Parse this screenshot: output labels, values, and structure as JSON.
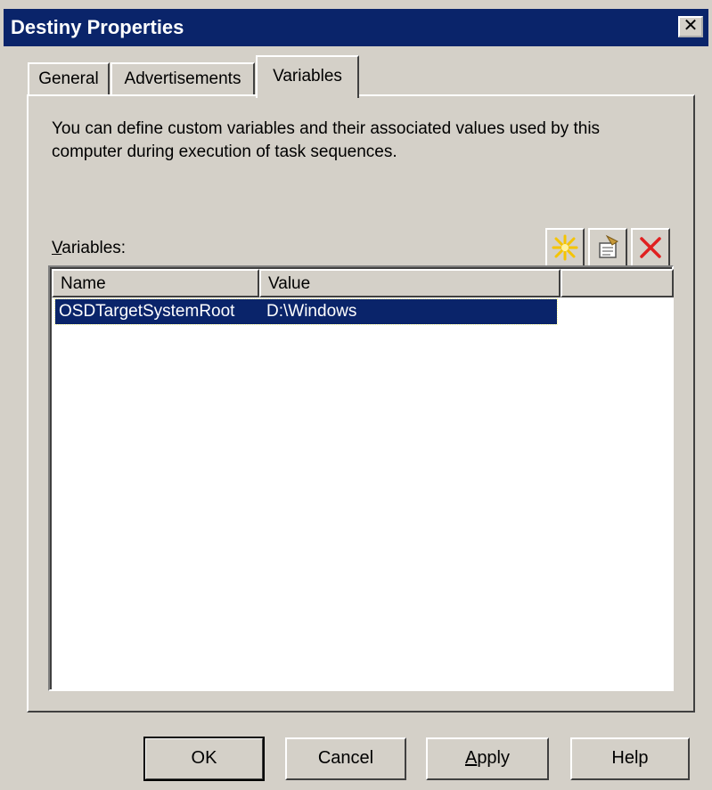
{
  "window": {
    "title": "Destiny Properties",
    "close_glyph": "✕"
  },
  "tabs": [
    {
      "label": "General",
      "selected": false
    },
    {
      "label": "Advertisements",
      "selected": false
    },
    {
      "label": "Variables",
      "selected": true
    }
  ],
  "variables_tab": {
    "description": "You can define custom variables and their associated values used by this computer during execution of task sequences.",
    "label_prefix": "V",
    "label_rest": "ariables:",
    "toolbar": {
      "new_icon": "new-star-icon",
      "properties_icon": "properties-icon",
      "delete_icon": "delete-x-icon"
    },
    "table": {
      "columns": [
        "Name",
        "Value"
      ],
      "rows": [
        {
          "name": "OSDTargetSystemRoot",
          "value": "D:\\Windows",
          "selected": true
        }
      ]
    }
  },
  "buttons": {
    "ok": "OK",
    "cancel": "Cancel",
    "apply_prefix": "A",
    "apply_rest": "pply",
    "help": "Help"
  },
  "colors": {
    "titlebar": "#0a246a",
    "face": "#d4d0c8",
    "selection": "#0a246a",
    "delete_icon": "#e02020",
    "new_icon": "#f5c400"
  }
}
